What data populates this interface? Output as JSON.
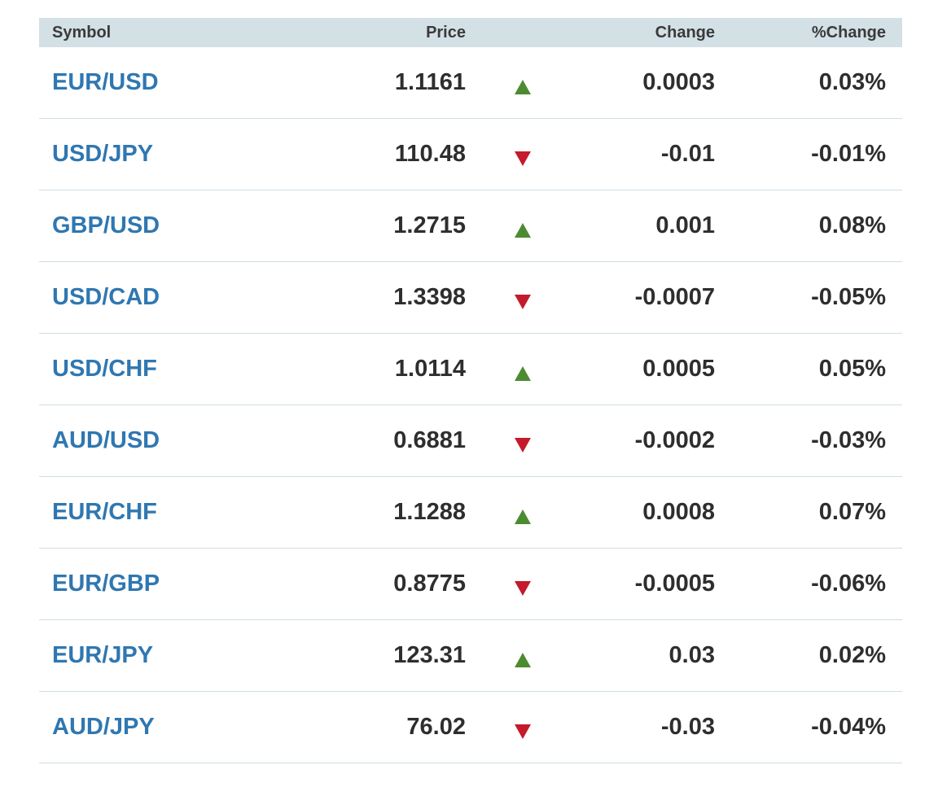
{
  "headers": {
    "symbol": "Symbol",
    "price": "Price",
    "change": "Change",
    "pct_change": "%Change"
  },
  "colors": {
    "up": "#4d8b31",
    "down": "#c41a2b",
    "link": "#2f77b1",
    "header_bg": "#d3e0e6"
  },
  "rows": [
    {
      "symbol": "EUR/USD",
      "price": "1.1161",
      "direction": "up",
      "icon": "triangle-up-icon",
      "change": "0.0003",
      "pct_change": "0.03%"
    },
    {
      "symbol": "USD/JPY",
      "price": "110.48",
      "direction": "down",
      "icon": "triangle-down-icon",
      "change": "-0.01",
      "pct_change": "-0.01%"
    },
    {
      "symbol": "GBP/USD",
      "price": "1.2715",
      "direction": "up",
      "icon": "triangle-up-icon",
      "change": "0.001",
      "pct_change": "0.08%"
    },
    {
      "symbol": "USD/CAD",
      "price": "1.3398",
      "direction": "down",
      "icon": "triangle-down-icon",
      "change": "-0.0007",
      "pct_change": "-0.05%"
    },
    {
      "symbol": "USD/CHF",
      "price": "1.0114",
      "direction": "up",
      "icon": "triangle-up-icon",
      "change": "0.0005",
      "pct_change": "0.05%"
    },
    {
      "symbol": "AUD/USD",
      "price": "0.6881",
      "direction": "down",
      "icon": "triangle-down-icon",
      "change": "-0.0002",
      "pct_change": "-0.03%"
    },
    {
      "symbol": "EUR/CHF",
      "price": "1.1288",
      "direction": "up",
      "icon": "triangle-up-icon",
      "change": "0.0008",
      "pct_change": "0.07%"
    },
    {
      "symbol": "EUR/GBP",
      "price": "0.8775",
      "direction": "down",
      "icon": "triangle-down-icon",
      "change": "-0.0005",
      "pct_change": "-0.06%"
    },
    {
      "symbol": "EUR/JPY",
      "price": "123.31",
      "direction": "up",
      "icon": "triangle-up-icon",
      "change": "0.03",
      "pct_change": "0.02%"
    },
    {
      "symbol": "AUD/JPY",
      "price": "76.02",
      "direction": "down",
      "icon": "triangle-down-icon",
      "change": "-0.03",
      "pct_change": "-0.04%"
    }
  ]
}
